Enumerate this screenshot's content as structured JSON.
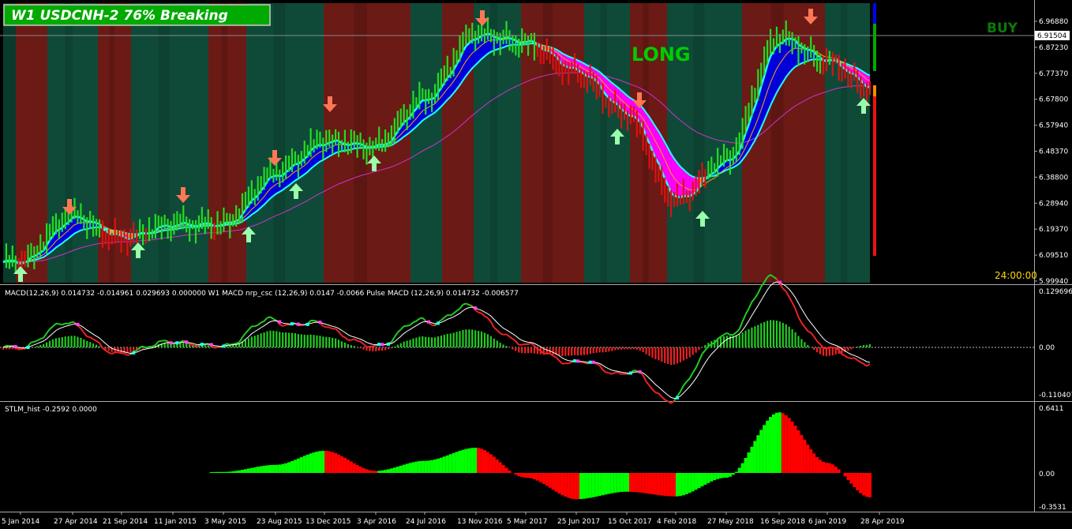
{
  "chart_title": "W1 USDCNH-2  76% Breaking",
  "signal_label": "LONG",
  "side_label": "BUY",
  "timer": "24:00:00",
  "colors": {
    "background": "#000000",
    "band_red": "#6b1a15",
    "band_green": "#0f4a38",
    "band_green_dark": "#0a3a2c",
    "bull_bar": "#22dd22",
    "bear_bar": "#dd1111",
    "ribbon_fast": "#22ffff",
    "ribbon_blue": "#0000dd",
    "ribbon_orange": "#ffa500",
    "ribbon_magenta": "#ff00ff",
    "ma_long": "#cc33cc",
    "arrow_up": "#99ffaa",
    "arrow_down": "#ff7755",
    "macd_line_green": "#22cc22",
    "macd_line_red": "#ee2222",
    "signal_line": "#ffffff",
    "stlm_green": "#00ff00",
    "stlm_red": "#ff0000",
    "title_box": "#00aa00"
  },
  "price_axis": {
    "ticks": [
      "6.96880",
      "6.87230",
      "6.77370",
      "6.67800",
      "6.57940",
      "6.48370",
      "6.38800",
      "6.28940",
      "6.19370",
      "6.09510",
      "5.99940"
    ],
    "current_price": "6.91504"
  },
  "macd_panel": {
    "label": "MACD(12,26,9) 0.014732 -0.014961 0.029693 0.000000  W1 MACD nrp_csc (12,26,9) 0.0147 -0.0066  Pulse MACD (12,26,9) 0.014732 -0.006577",
    "ticks": [
      "0.129696",
      "0.00",
      "-0.110407"
    ]
  },
  "stlm_panel": {
    "label": "STLM_hist -0.2592 0.0000",
    "ticks": [
      "0.6411",
      "0.00",
      "-0.3531"
    ]
  },
  "date_axis": [
    "5 Jan 2014",
    "27 Apr 2014",
    "21 Sep 2014",
    "11 Jan 2015",
    "3 May 2015",
    "23 Aug 2015",
    "13 Dec 2015",
    "3 Apr 2016",
    "24 Jul 2016",
    "13 Nov 2016",
    "5 Mar 2017",
    "25 Jun 2017",
    "15 Oct 2017",
    "4 Feb 2018",
    "27 May 2018",
    "16 Sep 2018",
    "6 Jan 2019",
    "28 Apr 2019"
  ],
  "chart_data": [
    {
      "type": "line",
      "title": "W1 USDCNH-2  76% Breaking",
      "x": [
        "5 Jan 2014",
        "27 Apr 2014",
        "21 Sep 2014",
        "11 Jan 2015",
        "3 May 2015",
        "23 Aug 2015",
        "13 Dec 2015",
        "3 Apr 2016",
        "24 Jul 2016",
        "13 Nov 2016",
        "5 Mar 2017",
        "25 Jun 2017",
        "15 Oct 2017",
        "4 Feb 2018",
        "27 May 2018",
        "16 Sep 2018",
        "6 Jan 2019",
        "28 Apr 2019"
      ],
      "ylim": [
        5.9994,
        6.9688
      ],
      "series": [
        {
          "values": [
            6.07,
            6.24,
            6.16,
            6.21,
            6.21,
            6.4,
            6.52,
            6.5,
            6.68,
            6.92,
            6.89,
            6.78,
            6.62,
            6.3,
            6.45,
            6.91,
            6.82,
            6.72
          ]
        }
      ]
    },
    {
      "type": "bar",
      "x": [
        "5 Jan 2014",
        "27 Apr 2014",
        "21 Sep 2014",
        "11 Jan 2015",
        "3 May 2015",
        "23 Aug 2015",
        "13 Dec 2015",
        "3 Apr 2016",
        "24 Jul 2016",
        "13 Nov 2016",
        "5 Mar 2017",
        "25 Jun 2017",
        "15 Oct 2017",
        "4 Feb 2018",
        "27 May 2018",
        "16 Sep 2018",
        "6 Jan 2019",
        "28 Apr 2019"
      ],
      "ylim": [
        -0.110407,
        0.129696
      ],
      "series": [
        {
          "values": [
            -0.005,
            0.015,
            -0.01,
            0.008,
            0.002,
            0.025,
            0.015,
            -0.01,
            0.012,
            0.022,
            -0.015,
            -0.012,
            0.008,
            -0.015,
            0.02,
            0.03,
            -0.02,
            0.015
          ]
        }
      ]
    },
    {
      "type": "bar",
      "x": [
        "5 Jan 2014",
        "27 Apr 2014",
        "21 Sep 2014",
        "11 Jan 2015",
        "3 May 2015",
        "23 Aug 2015",
        "13 Dec 2015",
        "3 Apr 2016",
        "24 Jul 2016",
        "13 Nov 2016",
        "5 Mar 2017",
        "25 Jun 2017",
        "15 Oct 2017",
        "4 Feb 2018",
        "27 May 2018",
        "16 Sep 2018",
        "6 Jan 2019",
        "28 Apr 2019"
      ],
      "ylim": [
        -0.3531,
        0.6411
      ],
      "series": [
        {
          "values": [
            0,
            0,
            0,
            0,
            0.01,
            0.08,
            0.22,
            0.02,
            0.12,
            0.25,
            -0.05,
            -0.28,
            -0.2,
            -0.25,
            -0.05,
            0.6,
            0.1,
            -0.26
          ]
        }
      ]
    }
  ]
}
